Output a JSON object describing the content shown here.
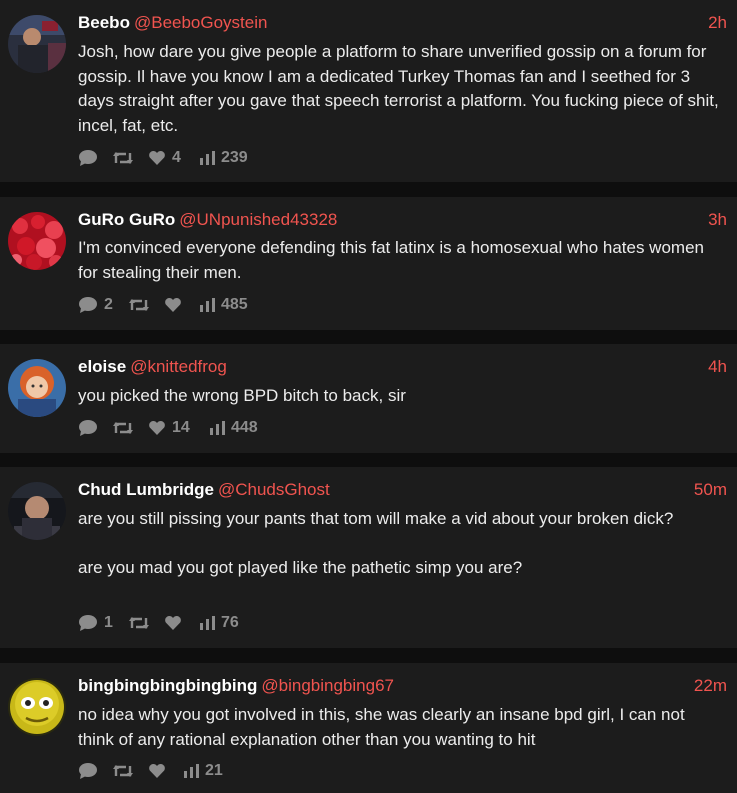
{
  "posts": [
    {
      "name": "Beebo",
      "handle": "@BeeboGoystein",
      "time": "2h",
      "text": "Josh, how dare you give people a platform to share unverified gossip on a forum for gossip. Il have you know I am a dedicated Turkey Thomas fan and I seethed for 3 days straight after you gave that speech terrorist a platform. You fucking piece of shit, incel, fat, etc.",
      "replies": "",
      "reposts": "",
      "likes": "4",
      "views": "239"
    },
    {
      "name": "GuRo GuRo",
      "handle": "@UNpunished43328",
      "time": "3h",
      "text": "I'm convinced everyone defending this fat latinx is a homosexual who hates women for stealing their men.",
      "replies": "2",
      "reposts": "",
      "likes": "",
      "views": "485"
    },
    {
      "name": "eloise",
      "handle": "@knittedfrog",
      "time": "4h",
      "text": "you picked the wrong BPD bitch to back, sir",
      "replies": "",
      "reposts": "",
      "likes": "14",
      "views": "448"
    },
    {
      "name": "Chud Lumbridge",
      "handle": "@ChudsGhost",
      "time": "50m",
      "text": "are you still pissing your pants that tom will make a vid about your broken dick?\n\nare you mad you got played like the pathetic simp you are?",
      "replies": "1",
      "reposts": "",
      "likes": "",
      "views": "76"
    },
    {
      "name": "bingbingbingbingbing",
      "handle": "@bingbingbing67",
      "time": "22m",
      "text": "no idea why you got involved in this, she was clearly an insane bpd girl, I can not think of any rational explanation other than you wanting to hit",
      "replies": "",
      "reposts": "",
      "likes": "",
      "views": "21"
    }
  ],
  "colors": {
    "accent": "#f0544f",
    "card": "#1c1c1c",
    "gap": "#0e0e0e",
    "icon": "#8c8c8c"
  },
  "icons": [
    "comment-icon",
    "repost-icon",
    "heart-icon",
    "views-icon"
  ]
}
